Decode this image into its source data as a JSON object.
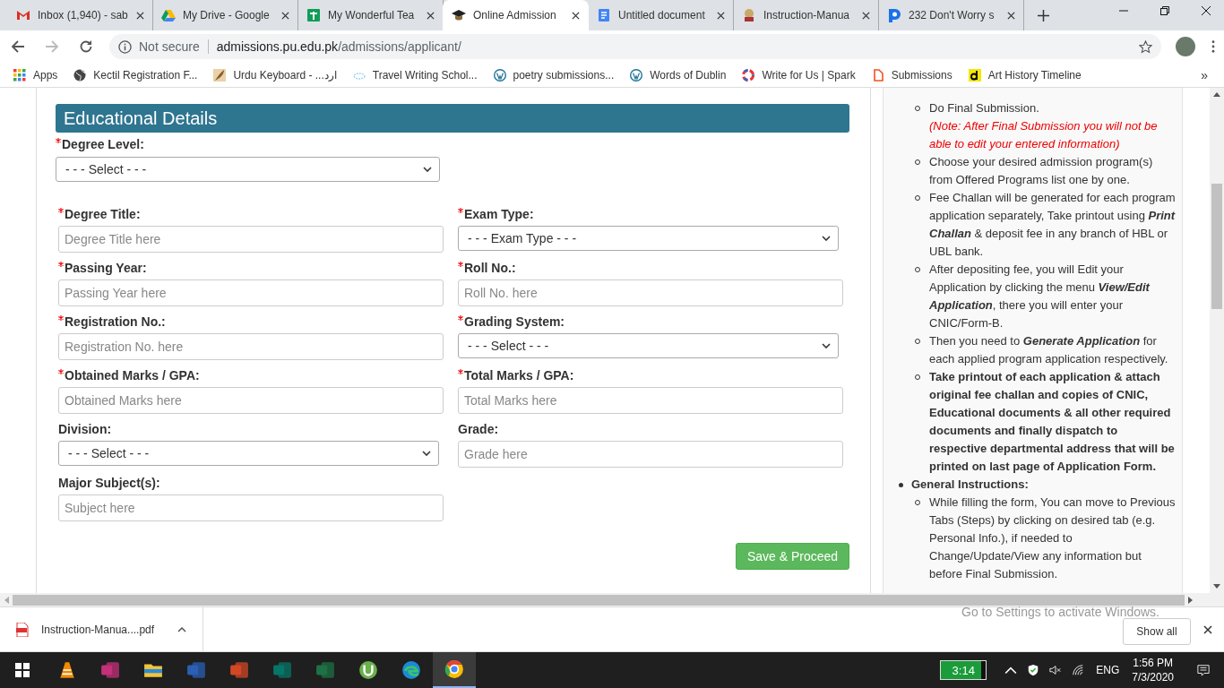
{
  "browser": {
    "tabs": [
      {
        "title": "Inbox (1,940) - sab",
        "selected": false
      },
      {
        "title": "My Drive - Google",
        "selected": false
      },
      {
        "title": "My Wonderful Tea",
        "selected": false
      },
      {
        "title": "Online Admission",
        "selected": true
      },
      {
        "title": "Untitled document",
        "selected": false
      },
      {
        "title": "Instruction-Manua",
        "selected": false
      },
      {
        "title": "232 Don't Worry s",
        "selected": false
      }
    ],
    "security": "Not secure",
    "url_host": "admissions.pu.edu.pk",
    "url_path": "/admissions/applicant/",
    "bookmarks": [
      {
        "label": "Apps"
      },
      {
        "label": "Kectil Registration F..."
      },
      {
        "label": "Urdu Keyboard - ...ارد"
      },
      {
        "label": "Travel Writing Schol..."
      },
      {
        "label": "poetry submissions..."
      },
      {
        "label": "Words of Dublin"
      },
      {
        "label": "Write for Us | Spark"
      },
      {
        "label": "Submissions"
      },
      {
        "label": "Art History Timeline"
      }
    ],
    "bookmarks_more": "»"
  },
  "form": {
    "title": "Educational Details",
    "degree_level": {
      "label": "Degree Level:",
      "required": true,
      "kind": "select",
      "value": "- - - Select - - -"
    },
    "fields": [
      {
        "label": "Degree Title:",
        "required": true,
        "kind": "input",
        "placeholder": "Degree Title here"
      },
      {
        "label": "Exam Type:",
        "required": true,
        "kind": "select",
        "value": "- - - Exam Type - - -"
      },
      {
        "label": "Passing Year:",
        "required": true,
        "kind": "input",
        "placeholder": "Passing Year here"
      },
      {
        "label": "Roll No.:",
        "required": true,
        "kind": "input",
        "placeholder": "Roll No. here"
      },
      {
        "label": "Registration No.:",
        "required": true,
        "kind": "input",
        "placeholder": "Registration No. here"
      },
      {
        "label": "Grading System:",
        "required": true,
        "kind": "select",
        "value": "- - - Select - - -"
      },
      {
        "label": "Obtained Marks / GPA:",
        "required": true,
        "kind": "input",
        "placeholder": "Obtained Marks here"
      },
      {
        "label": "Total Marks / GPA:",
        "required": true,
        "kind": "input",
        "placeholder": "Total Marks here"
      },
      {
        "label": "Division:",
        "required": false,
        "kind": "select",
        "value": "- - - Select - - -"
      },
      {
        "label": "Grade:",
        "required": false,
        "kind": "input",
        "placeholder": "Grade here"
      },
      {
        "label": "Major Subject(s):",
        "required": false,
        "kind": "input",
        "placeholder": "Subject here"
      }
    ],
    "submit": "Save & Proceed"
  },
  "instructions": {
    "steps": [
      {
        "text": "Do Final Submission.",
        "note": "(Note: After Final Submission you will not be able to edit your entered information)",
        "bold": false
      },
      {
        "text": "Choose your desired admission program(s) from Offered Programs list one by one.",
        "bold": false
      },
      {
        "text": "Fee Challan will be generated for each program application separately, Take printout using **Print Challan** & deposit fee in any branch of HBL or UBL bank.",
        "bold": false
      },
      {
        "text": "After depositing fee, you will Edit your Application by clicking the menu **View/Edit Application**, there you will enter your CNIC/Form-B.",
        "bold": false
      },
      {
        "text": "Then you need to **Generate Application** for each applied program application respectively.",
        "bold": false
      },
      {
        "text": "Take printout of each application & attach original fee challan and copies of CNIC, Educational documents & all other required documents and finally dispatch to respective departmental address that will be printed on last page of Application Form.",
        "bold": true
      }
    ],
    "general": {
      "heading": "General Instructions:",
      "items": [
        {
          "text": "While filling the form, You can move to Previous Tabs (Steps) by clicking on desired tab (e.g. Personal Info.), if needed to Change/Update/View any information but before Final Submission.",
          "bold": false
        }
      ]
    }
  },
  "downloads": {
    "file": "Instruction-Manua....pdf",
    "show_all": "Show all"
  },
  "os_notice": "Go to Settings to activate Windows.",
  "taskbar": {
    "apps": [
      {
        "kind": "vlc",
        "selected": false
      },
      {
        "kind": "pdf",
        "selected": false
      },
      {
        "kind": "folder",
        "selected": false
      },
      {
        "kind": "word",
        "selected": false
      },
      {
        "kind": "powerpoint",
        "selected": false
      },
      {
        "kind": "publisher",
        "selected": false
      },
      {
        "kind": "excel",
        "selected": false
      },
      {
        "kind": "torrent",
        "selected": false
      },
      {
        "kind": "edge",
        "selected": false
      },
      {
        "kind": "chrome",
        "selected": true
      }
    ],
    "battery": "3:14",
    "language": "ENG",
    "time": "1:56 PM",
    "date": "7/3/2020"
  }
}
